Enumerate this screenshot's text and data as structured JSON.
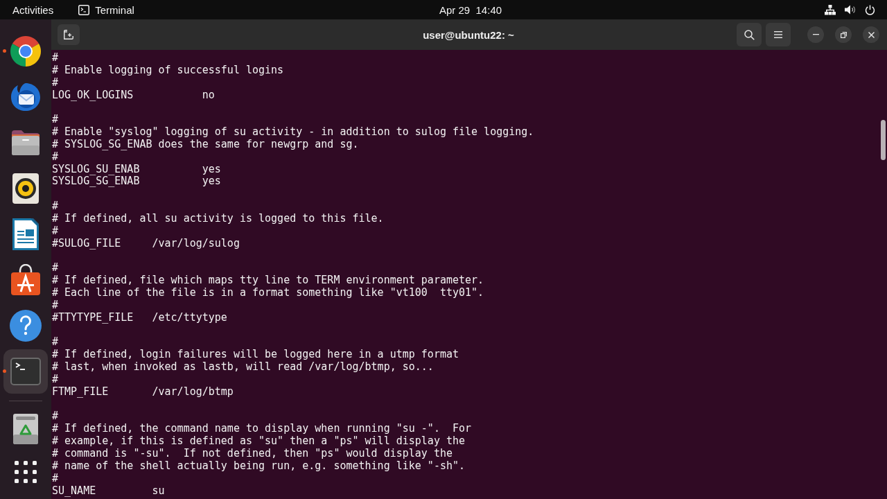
{
  "top_bar": {
    "activities": "Activities",
    "app_menu": {
      "label": "Terminal"
    },
    "clock": "Apr 29  14:40"
  },
  "dock": {
    "favorites": [
      {
        "kind": "browser",
        "running": true,
        "focused": false
      },
      {
        "kind": "mail",
        "running": false,
        "focused": false
      },
      {
        "kind": "files",
        "running": false,
        "focused": false
      },
      {
        "kind": "music",
        "running": false,
        "focused": false
      },
      {
        "kind": "writer",
        "running": false,
        "focused": false
      },
      {
        "kind": "app-store",
        "running": false,
        "focused": false
      },
      {
        "kind": "help",
        "running": false,
        "focused": false
      },
      {
        "kind": "terminal",
        "running": true,
        "focused": true
      }
    ],
    "others": [
      {
        "kind": "trash",
        "running": false,
        "focused": false
      }
    ]
  },
  "terminal": {
    "title": "user@ubuntu22: ~",
    "blocks": [
      {
        "lines": [
          "#",
          "# Enable logging of successful logins",
          "#",
          "LOG_OK_LOGINS           no"
        ]
      },
      {
        "lines": [
          "#",
          "# Enable \"syslog\" logging of su activity - in addition to sulog file logging.",
          "# SYSLOG_SG_ENAB does the same for newgrp and sg.",
          "#",
          "SYSLOG_SU_ENAB          yes",
          "SYSLOG_SG_ENAB          yes"
        ]
      },
      {
        "lines": [
          "#",
          "# If defined, all su activity is logged to this file.",
          "#",
          "#SULOG_FILE     /var/log/sulog"
        ]
      },
      {
        "lines": [
          "#",
          "# If defined, file which maps tty line to TERM environment parameter.",
          "# Each line of the file is in a format something like \"vt100  tty01\".",
          "#",
          "#TTYTYPE_FILE   /etc/ttytype"
        ]
      },
      {
        "lines": [
          "#",
          "# If defined, login failures will be logged here in a utmp format",
          "# last, when invoked as lastb, will read /var/log/btmp, so...",
          "#",
          "FTMP_FILE       /var/log/btmp"
        ]
      },
      {
        "lines": [
          "#",
          "# If defined, the command name to display when running \"su -\".  For",
          "# example, if this is defined as \"su\" then a \"ps\" will display the",
          "# command is \"-su\".  If not defined, then \"ps\" would display the",
          "# name of the shell actually being run, e.g. something like \"-sh\".",
          "#",
          "SU_NAME         su"
        ]
      }
    ]
  }
}
